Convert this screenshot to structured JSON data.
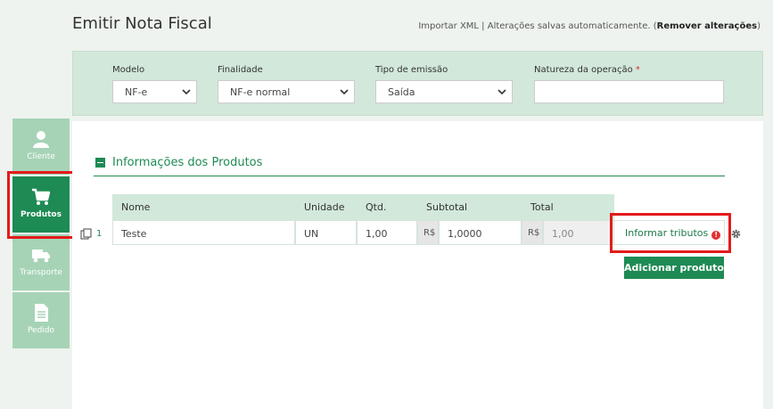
{
  "page_title": "Emitir Nota Fiscal",
  "top_bar": {
    "import_link": "Importar XML",
    "separator": " | ",
    "autosave_text": "Alterações salvas automaticamente.",
    "remove_open": " (",
    "remove_link": "Remover alterações",
    "remove_close": ")"
  },
  "header_fields": {
    "modelo": {
      "label": "Modelo",
      "value": "NF-e"
    },
    "finalidade": {
      "label": "Finalidade",
      "value": "NF-e normal"
    },
    "tipo_emissao": {
      "label": "Tipo de emissão",
      "value": "Saída"
    },
    "natureza": {
      "label": "Natureza da operação",
      "required_mark": "*",
      "value": ""
    }
  },
  "sidebar": {
    "items": [
      {
        "label": "Cliente",
        "icon": "user-icon",
        "active": false
      },
      {
        "label": "Produtos",
        "icon": "cart-icon",
        "active": true
      },
      {
        "label": "Transporte",
        "icon": "truck-icon",
        "active": false
      },
      {
        "label": "Pedido",
        "icon": "document-icon",
        "active": false
      }
    ]
  },
  "section": {
    "title": "Informações dos Produtos"
  },
  "table": {
    "headers": {
      "nome": "Nome",
      "unidade": "Unidade",
      "qtd": "Qtd.",
      "subtotal": "Subtotal",
      "total": "Total"
    },
    "rows": [
      {
        "index": "1",
        "nome": "Teste",
        "unidade": "UN",
        "qtd": "1,00",
        "subtotal_prefix": "R$",
        "subtotal": "1,0000",
        "total_prefix": "R$",
        "total": "1,00"
      }
    ]
  },
  "buttons": {
    "informar_tributos": "Informar tributos",
    "tributos_alert": "!",
    "adicionar_produto": "Adicionar produto"
  },
  "colors": {
    "brand_green": "#1e8a54",
    "light_green": "#d2e8da",
    "tab_inactive": "#a6d3b6",
    "highlight_red": "#e31b1b",
    "alert_red": "#e03030"
  }
}
